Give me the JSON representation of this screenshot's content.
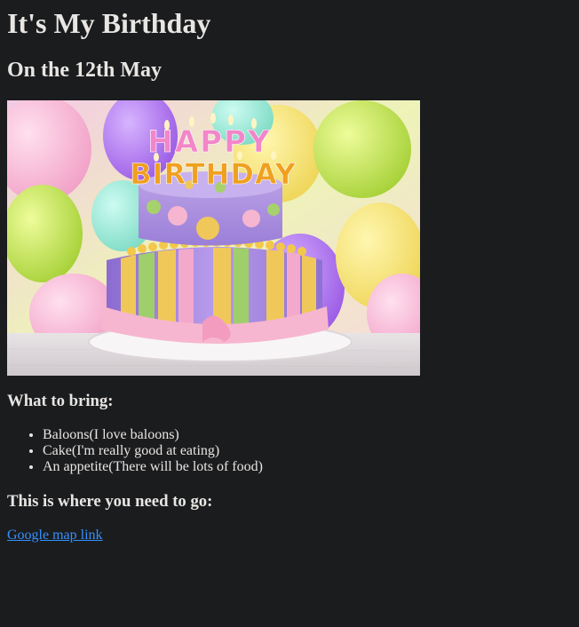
{
  "page": {
    "title": "It's My Birthday",
    "subtitle": "On the 12th May"
  },
  "image": {
    "cake_text_line1": "HAPPY",
    "cake_text_line2": "BIRTHDAY"
  },
  "bring": {
    "heading": "What to bring:",
    "items": [
      "Baloons(I love baloons)",
      "Cake(I'm really good at eating)",
      "An appetite(There will be lots of food)"
    ]
  },
  "location": {
    "heading": "This is where you need to go:",
    "link_text": "Google map link"
  },
  "colors": {
    "background": "#1b1c1e",
    "text": "#e8e6e3",
    "link": "#3391ff"
  }
}
